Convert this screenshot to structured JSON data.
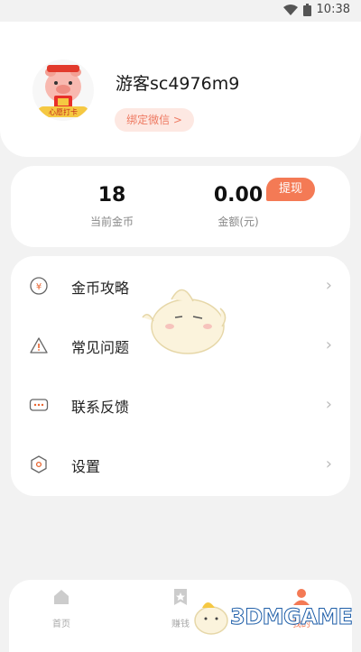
{
  "status_bar": {
    "time": "10:38",
    "icons": [
      "wifi-icon",
      "battery-icon"
    ]
  },
  "profile": {
    "username": "游客sc4976m9",
    "bind_wechat_label": "绑定微信 >",
    "avatar_badge_text": "心愿打卡"
  },
  "stats": {
    "coins_value": "18",
    "coins_label": "当前金币",
    "amount_value": "0.00",
    "amount_label": "金额(元)",
    "withdraw_label": "提现"
  },
  "menu": {
    "items": [
      {
        "label": "金币攻略",
        "icon": "yen-coin-icon"
      },
      {
        "label": "常见问题",
        "icon": "warning-icon"
      },
      {
        "label": "联系反馈",
        "icon": "message-icon"
      },
      {
        "label": "设置",
        "icon": "hexagon-settings-icon"
      }
    ]
  },
  "tabbar": {
    "tabs": [
      {
        "label": "首页",
        "icon": "home-icon"
      },
      {
        "label": "赚钱",
        "icon": "star-bookmark-icon"
      },
      {
        "label": "我的",
        "icon": "profile-icon"
      }
    ]
  },
  "watermark": {
    "text": "3DMGAME"
  },
  "colors": {
    "accent": "#f47a55",
    "bind_bg": "#fde8e2",
    "page_bg": "#f2f2f2"
  }
}
